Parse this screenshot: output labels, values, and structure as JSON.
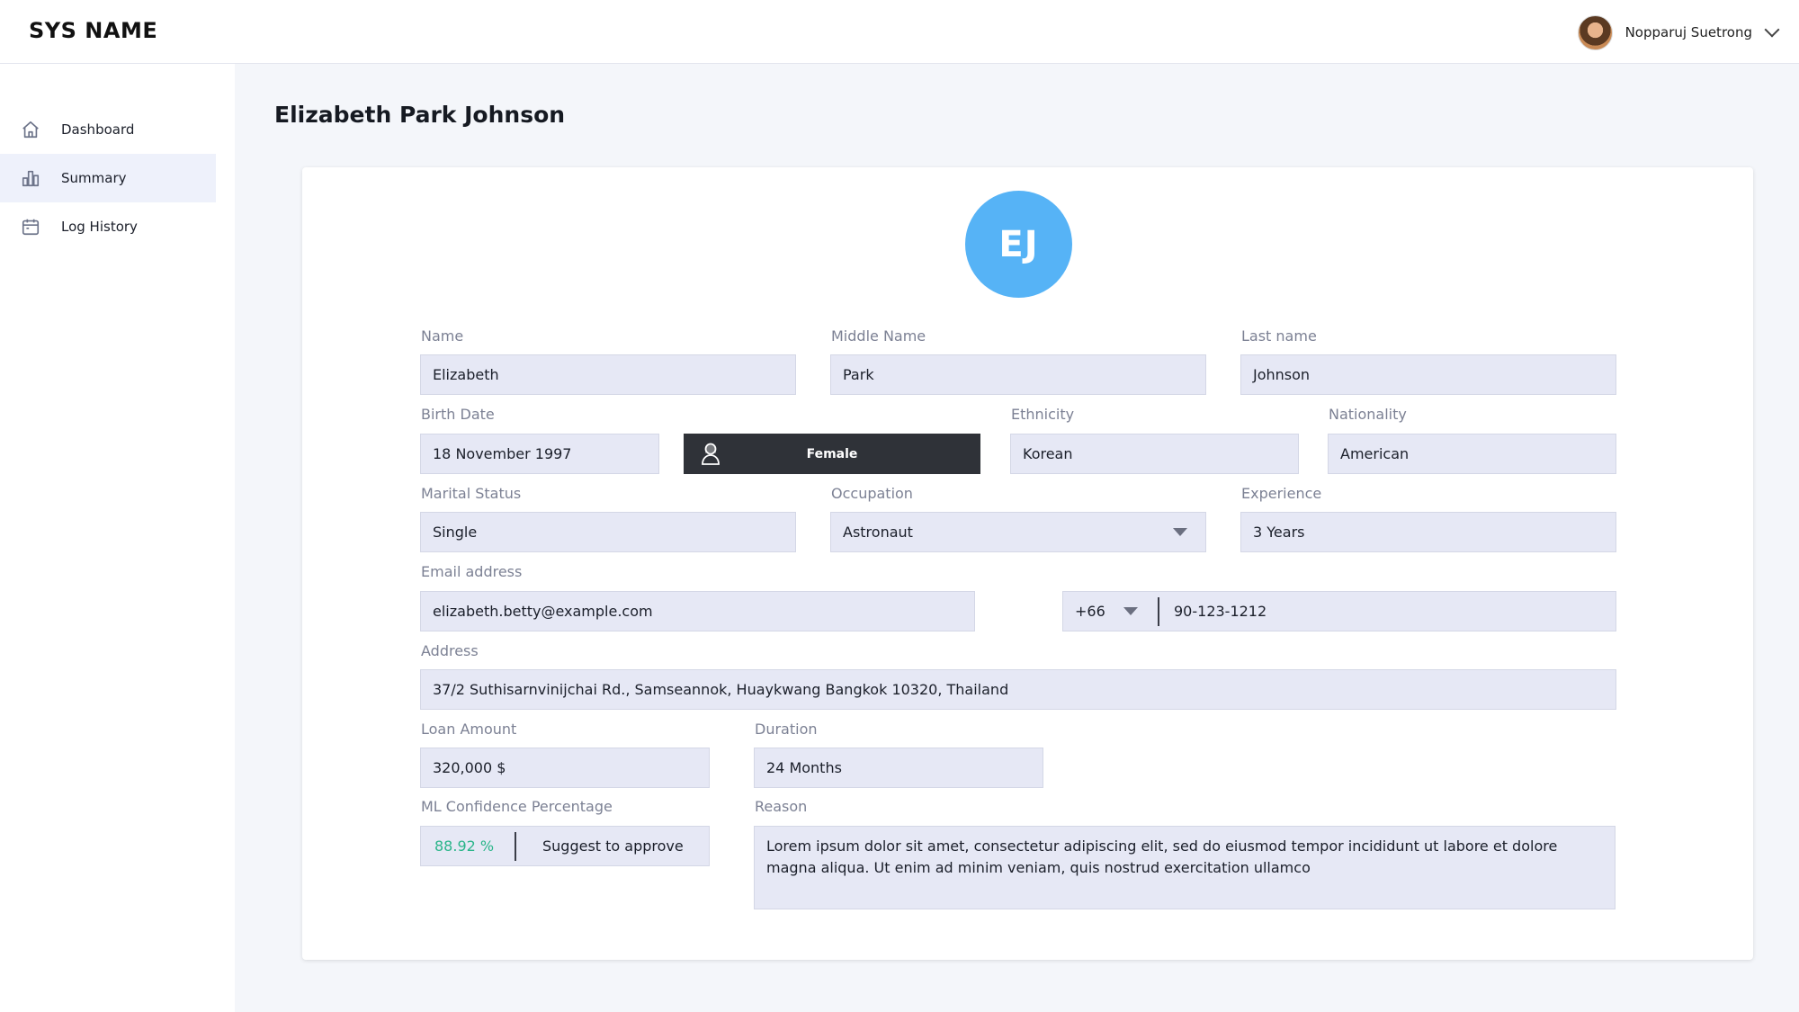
{
  "app": {
    "title": "SYS NAME"
  },
  "user": {
    "name": "Nopparuj Suetrong"
  },
  "sidebar": {
    "items": [
      {
        "label": "Dashboard",
        "icon": "home-icon"
      },
      {
        "label": "Summary",
        "icon": "bar-chart-icon",
        "active": true
      },
      {
        "label": "Log History",
        "icon": "calendar-icon"
      }
    ]
  },
  "profile": {
    "title": "Elizabeth Park Johnson",
    "initials": "EJ",
    "initials_color": "#56b3f6",
    "fields": {
      "name": {
        "label": "Name",
        "value": "Elizabeth"
      },
      "middle_name": {
        "label": "Middle Name",
        "value": "Park"
      },
      "last_name": {
        "label": "Last name",
        "value": "Johnson"
      },
      "birth_date": {
        "label": "Birth Date",
        "value": "18 November 1997"
      },
      "gender": {
        "value": "Female"
      },
      "ethnicity": {
        "label": "Ethnicity",
        "value": "Korean"
      },
      "nationality": {
        "label": "Nationality",
        "value": "American"
      },
      "marital_status": {
        "label": "Marital Status",
        "value": "Single"
      },
      "occupation": {
        "label": "Occupation",
        "value": "Astronaut"
      },
      "experience": {
        "label": "Experience",
        "value": "3 Years"
      },
      "email": {
        "label": "Email address",
        "value": "elizabeth.betty@example.com"
      },
      "phone": {
        "code": "+66",
        "number": "90-123-1212"
      },
      "address": {
        "label": "Address",
        "value": "37/2 Suthisarnvinijchai Rd., Samseannok, Huaykwang Bangkok 10320, Thailand"
      },
      "loan_amount": {
        "label": "Loan Amount",
        "value": "320,000 $"
      },
      "duration": {
        "label": "Duration",
        "value": "24 Months"
      },
      "ml_confidence": {
        "label": "ML Confidence Percentage",
        "value": "88.92 %",
        "suggestion": "Suggest to approve",
        "value_color": "#2bb58a"
      },
      "reason": {
        "label": "Reason",
        "value": "Lorem ipsum dolor sit amet, consectetur adipiscing elit, sed do eiusmod tempor incididunt ut labore et dolore magna aliqua. Ut enim ad minim veniam, quis nostrud exercitation ullamco"
      }
    }
  }
}
